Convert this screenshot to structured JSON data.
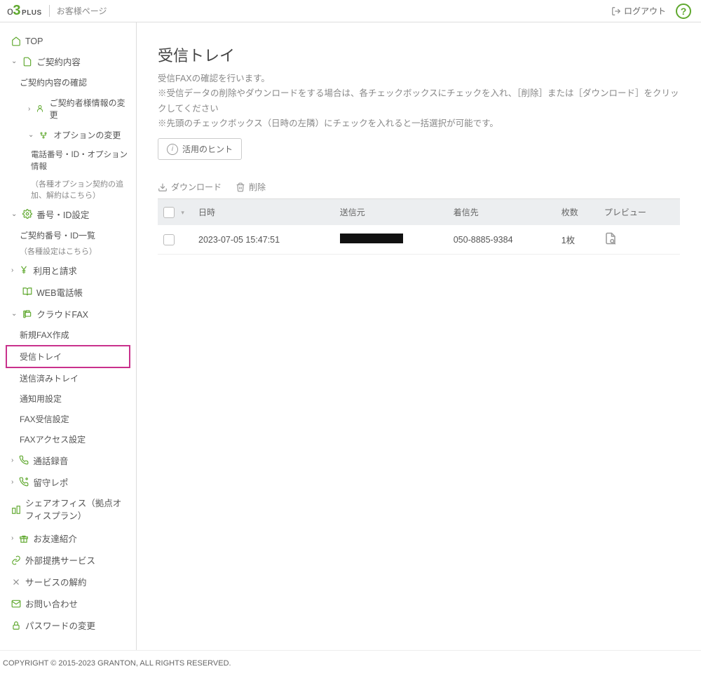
{
  "header": {
    "logo_o": "o",
    "logo_3": "3",
    "logo_plus": "PLUS",
    "page_label": "お客様ページ",
    "logout": "ログアウト",
    "help": "?"
  },
  "sidebar": {
    "top": "TOP",
    "contract": "ご契約内容",
    "contract_confirm": "ご契約内容の確認",
    "subscriber_change": "ご契約者様情報の変更",
    "option_change": "オプションの変更",
    "phone_option_info": "電話番号・ID・オプション情報",
    "phone_option_sub": "（各種オプション契約の追加、解約はこちら）",
    "number_id": "番号・ID設定",
    "number_id_list": "ご契約番号・ID一覧",
    "number_id_sub": "（各種設定はこちら）",
    "billing": "利用と請求",
    "web_phonebook": "WEB電話帳",
    "cloud_fax": "クラウドFAX",
    "new_fax": "新規FAX作成",
    "inbox": "受信トレイ",
    "sent": "送信済みトレイ",
    "notify_settings": "通知用設定",
    "fax_recv_settings": "FAX受信設定",
    "fax_access_settings": "FAXアクセス設定",
    "call_recording": "通話録音",
    "rusu_repo": "留守レポ",
    "share_office": "シェアオフィス（拠点オフィスプラン）",
    "referral": "お友達紹介",
    "external_service": "外部提携サービス",
    "cancel_service": "サービスの解約",
    "contact": "お問い合わせ",
    "password_change": "パスワードの変更"
  },
  "main": {
    "title": "受信トレイ",
    "desc1": "受信FAXの確認を行います。",
    "desc2": "※受信データの削除やダウンロードをする場合は、各チェックボックスにチェックを入れ、［削除］または［ダウンロード］をクリックしてください",
    "desc3": "※先頭のチェックボックス（日時の左隣）にチェックを入れると一括選択が可能です。",
    "hint": "活用のヒント",
    "download": "ダウンロード",
    "delete": "削除",
    "columns": {
      "datetime": "日時",
      "sender": "送信元",
      "recipient": "着信先",
      "pages": "枚数",
      "preview": "プレビュー"
    },
    "rows": [
      {
        "datetime": "2023-07-05 15:47:51",
        "sender": "",
        "recipient": "050-8885-9384",
        "pages": "1枚"
      }
    ]
  },
  "footer": "COPYRIGHT © 2015-2023 GRANTON, ALL RIGHTS RESERVED."
}
